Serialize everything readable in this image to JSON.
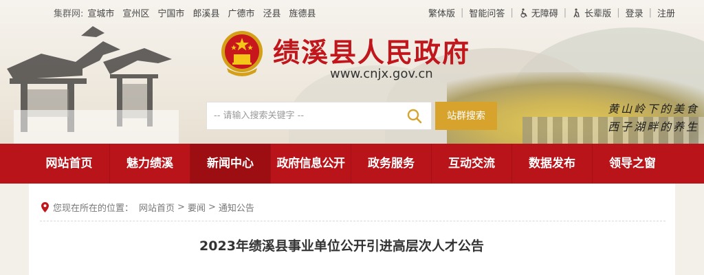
{
  "topbar": {
    "cluster_label": "集群网:",
    "cluster_items": [
      "宣城市",
      "宣州区",
      "宁国市",
      "郎溪县",
      "广德市",
      "泾县",
      "旌德县"
    ],
    "right_links": {
      "traditional": "繁体版",
      "smart_qa": "智能问答",
      "accessible": "无障碍",
      "elderly": "长辈版",
      "login": "登录",
      "register": "注册"
    }
  },
  "header": {
    "site_title": "绩溪县人民政府",
    "site_url": "www.cnjx.gov.cn",
    "slogan_line1": "黄山岭下的美食",
    "slogan_line2": "西子湖畔的养生"
  },
  "search": {
    "placeholder": "-- 请输入搜索关键字 --",
    "button_label": "站群搜索"
  },
  "nav": {
    "items": [
      "网站首页",
      "魅力绩溪",
      "新闻中心",
      "政府信息公开",
      "政务服务",
      "互动交流",
      "数据发布",
      "领导之窗"
    ],
    "active_index": 2
  },
  "breadcrumb": {
    "prefix": "您现在所在的位置：",
    "items": [
      "网站首页",
      "要闻",
      "通知公告"
    ],
    "separator": ">"
  },
  "article": {
    "title": "2023年绩溪县事业单位公开引进高层次人才公告"
  },
  "colors": {
    "brand_red": "#b8141a",
    "title_red": "#c0161c",
    "search_gold": "#d7a32c"
  }
}
